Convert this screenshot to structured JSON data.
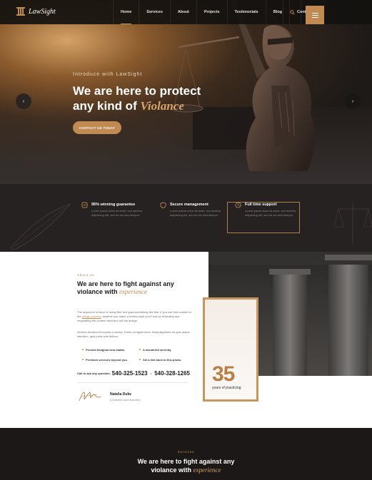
{
  "brand": {
    "name": "LawSight"
  },
  "nav": {
    "items": [
      {
        "label": "Home",
        "active": true
      },
      {
        "label": "Services"
      },
      {
        "label": "About"
      },
      {
        "label": "Projects"
      },
      {
        "label": "Testimonials"
      },
      {
        "label": "Blog"
      },
      {
        "label": "Contact"
      }
    ]
  },
  "hero": {
    "kicker": "Introduce with LawSight",
    "title_line1": "We are here to protect",
    "title_line2_prefix": "any kind of ",
    "title_accent": "Violance",
    "cta_label": "CONTACT US TODAY"
  },
  "features": [
    {
      "title": "95% winning guarantee",
      "text": "Lorem ipsum dolor sit amet, con sectetu adipiscing elit, sed do eiu mod tempor."
    },
    {
      "title": "Secure management",
      "text": "Lorem ipsum dolor sit amet, con sectetu adipiscing elit, sed do eiu mod tempor."
    },
    {
      "title": "Full time support",
      "text": "Lorem ipsum dolor sit amet, con sectetu adipiscing elit, sed do eiu mod tempor."
    }
  ],
  "about": {
    "kicker": "About us",
    "title_line1": "We are here to fight against any",
    "title_line2_prefix": "violance with ",
    "title_accent": "experience",
    "para1_a": "The argument in favor of using filler text goes something like this: If you use real content in the ",
    "para1_link": "design process",
    "para1_b": ", anytime you reach a review point you'll end up reviewing and negotiating the content itself and not the design.",
    "para2": "Aenean tincidunt id mauris ut auctor. Donec at ligula lacus. Nulla dignissim mi quis neque interdum, quis porta sem finibus.",
    "bullets": [
      "Present fixogical sem mattis.",
      "A wonderful serenity.",
      "Premium services beyond you.",
      "Set a link back to this photo."
    ],
    "call_label": "Call to ask any question",
    "phone1": "540-325-1523",
    "call_or": "or",
    "phone2": "540-328-1265",
    "signer_name": "Natalia Duke",
    "signer_role": "(Chairmen and founder)",
    "counter_value": "35",
    "counter_label": "years of practicing"
  },
  "services": {
    "kicker": "Services",
    "title_line1": "We are here to fight against any",
    "title_line2_prefix": "violance with ",
    "title_accent": "experience"
  },
  "colors": {
    "accent": "#c08a52",
    "dark": "#1b1817",
    "panel": "#262221"
  }
}
